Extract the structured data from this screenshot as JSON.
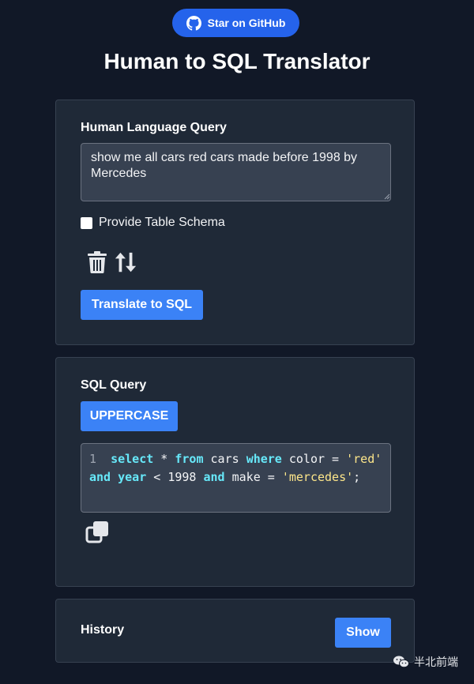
{
  "header": {
    "github_button": "Star on GitHub",
    "title": "Human to SQL Translator"
  },
  "input_card": {
    "label": "Human Language Query",
    "query_value": "show me all cars red cars made before 1998 by Mercedes",
    "schema_checkbox_label": "Provide Table Schema",
    "schema_checked": false,
    "translate_button": "Translate to SQL"
  },
  "output_card": {
    "label": "SQL Query",
    "uppercase_button": "UPPERCASE",
    "line_number": "1",
    "sql_tokens": [
      {
        "t": "select",
        "k": "kw"
      },
      {
        "t": " * ",
        "k": ""
      },
      {
        "t": "from",
        "k": "kw"
      },
      {
        "t": " cars ",
        "k": ""
      },
      {
        "t": "where",
        "k": "kw"
      },
      {
        "t": " color = ",
        "k": ""
      },
      {
        "t": "'red'",
        "k": "str"
      },
      {
        "t": " ",
        "k": ""
      },
      {
        "t": "and",
        "k": "kw"
      },
      {
        "t": " ",
        "k": ""
      },
      {
        "t": "year",
        "k": "kw"
      },
      {
        "t": " < 1998 ",
        "k": ""
      },
      {
        "t": "and",
        "k": "kw"
      },
      {
        "t": " make = ",
        "k": ""
      },
      {
        "t": "'mercedes'",
        "k": "str"
      },
      {
        "t": ";",
        "k": ""
      }
    ]
  },
  "history_card": {
    "label": "History",
    "show_button": "Show"
  },
  "watermark": "半北前端",
  "colors": {
    "background": "#111827",
    "card": "#1f2937",
    "accent": "#3b82f6",
    "github_button": "#2563eb",
    "keyword": "#67e8f9",
    "string": "#fde68a"
  },
  "icons": [
    "github-icon",
    "trash-icon",
    "swap-icon",
    "copy-icon",
    "wechat-icon"
  ]
}
